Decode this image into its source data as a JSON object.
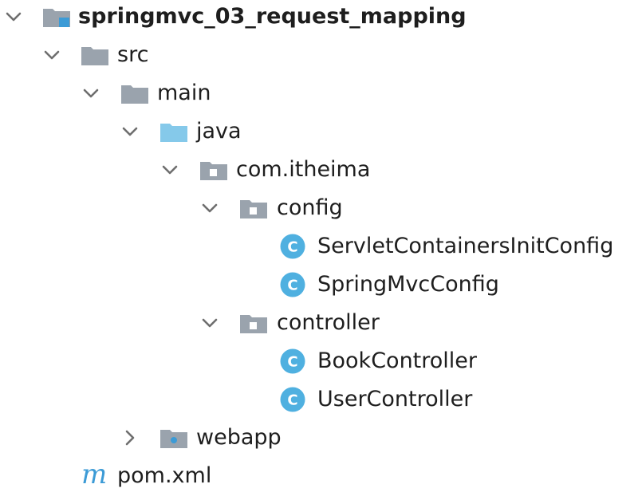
{
  "project_tree": {
    "root": {
      "label": "springmvc_03_request_mapping",
      "expanded": true,
      "icon": "module-folder-icon"
    },
    "src": {
      "label": "src",
      "expanded": true,
      "icon": "folder-icon"
    },
    "main": {
      "label": "main",
      "expanded": true,
      "icon": "folder-icon"
    },
    "java": {
      "label": "java",
      "expanded": true,
      "icon": "source-root-folder-icon"
    },
    "com_itheima": {
      "label": "com.itheima",
      "expanded": true,
      "icon": "package-icon"
    },
    "config": {
      "label": "config",
      "expanded": true,
      "icon": "package-icon",
      "children": [
        {
          "label": "ServletContainersInitConfig",
          "icon": "class-icon"
        },
        {
          "label": "SpringMvcConfig",
          "icon": "class-icon"
        }
      ]
    },
    "controller": {
      "label": "controller",
      "expanded": true,
      "icon": "package-icon",
      "children": [
        {
          "label": "BookController",
          "icon": "class-icon"
        },
        {
          "label": "UserController",
          "icon": "class-icon"
        }
      ]
    },
    "webapp": {
      "label": "webapp",
      "expanded": false,
      "icon": "web-folder-icon"
    },
    "pom": {
      "label": "pom.xml",
      "icon": "maven-icon",
      "icon_glyph": "m"
    }
  },
  "colors": {
    "chevron": "#6e6e6e",
    "folder_gray": "#9aa3ad",
    "folder_blue": "#85c9ea",
    "module_marker": "#3c9bd6",
    "class_circle": "#4fb0e0",
    "class_letter": "#ffffff",
    "maven_blue": "#3c9bd6",
    "text": "#1e1e1e"
  }
}
